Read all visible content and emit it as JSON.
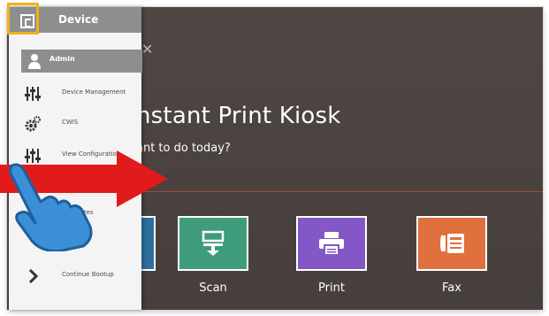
{
  "sidebar": {
    "header_title": "Device",
    "admin_label": "Admin",
    "items": [
      {
        "label": "Device Management",
        "icon": "sliders-icon"
      },
      {
        "label": "CWIS",
        "icon": "gears-icon"
      },
      {
        "label": "View Configuration",
        "icon": "sliders-icon"
      },
      {
        "label": "e Updates",
        "icon": "update-icon"
      },
      {
        "label": "Continue Bootup",
        "icon": "chevron-right-icon"
      }
    ]
  },
  "kiosk": {
    "title": "nstant Print Kiosk",
    "subtitle": "ant to do today?",
    "tiles": [
      {
        "label": "Scan",
        "color": "#3f9c7a",
        "icon": "scan-icon"
      },
      {
        "label": "Print",
        "color": "#8457c6",
        "icon": "printer-icon"
      },
      {
        "label": "Fax",
        "color": "#e0703d",
        "icon": "fax-icon"
      }
    ]
  },
  "colors": {
    "highlight": "#f2b01e",
    "arrow": "#e11b1b",
    "hand": "#3a8fd6",
    "sidebar_header": "#8e8e8e"
  }
}
